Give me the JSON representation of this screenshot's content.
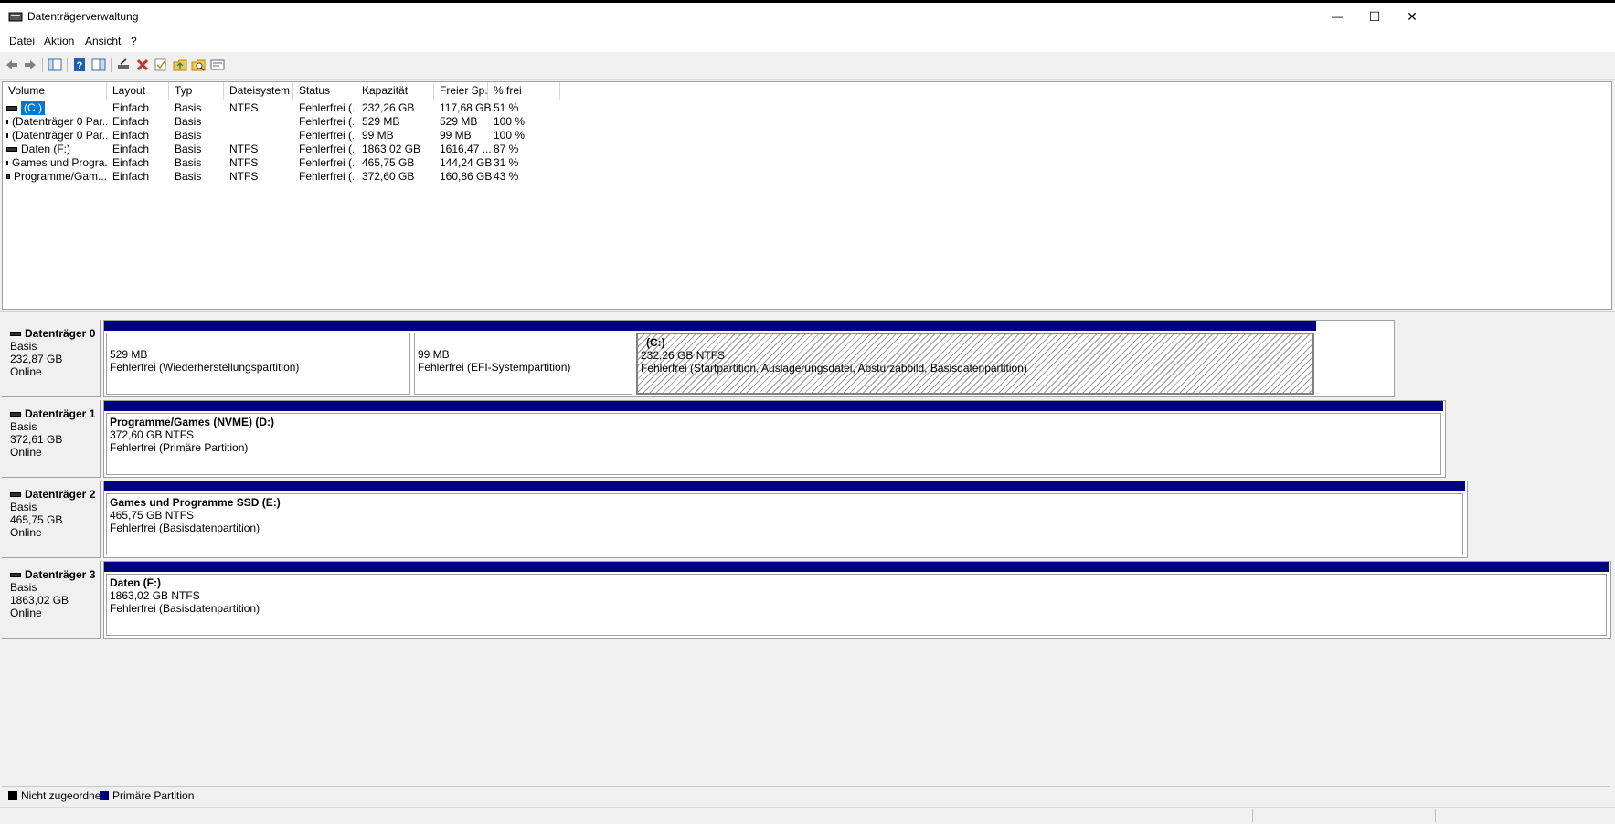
{
  "window": {
    "title": "Datenträgerverwaltung",
    "minimize_glyph": "—",
    "maximize_glyph": "☐",
    "close_glyph": "✕"
  },
  "menu": [
    "Datei",
    "Aktion",
    "Ansicht",
    "?"
  ],
  "toolbar_icons": [
    "back-icon",
    "forward-icon",
    "console-tree-icon",
    "help-icon",
    "action-pane-icon",
    "connect-disk-icon",
    "delete-icon",
    "check-icon",
    "folder-up-icon",
    "search-icon",
    "properties-icon"
  ],
  "columns": [
    "Volume",
    "Layout",
    "Typ",
    "Dateisystem",
    "Status",
    "Kapazität",
    "Freier Sp...",
    "% frei"
  ],
  "volumes": [
    {
      "volume": "(C:)",
      "layout": "Einfach",
      "typ": "Basis",
      "fs": "NTFS",
      "status": "Fehlerfrei (...",
      "kapazitaet": "232,26 GB",
      "frei": "117,68 GB",
      "prozent": "51 %"
    },
    {
      "volume": "(Datenträger 0 Par...",
      "layout": "Einfach",
      "typ": "Basis",
      "fs": "",
      "status": "Fehlerfrei (...",
      "kapazitaet": "529 MB",
      "frei": "529 MB",
      "prozent": "100 %"
    },
    {
      "volume": "(Datenträger 0 Par...",
      "layout": "Einfach",
      "typ": "Basis",
      "fs": "",
      "status": "Fehlerfrei (...",
      "kapazitaet": "99 MB",
      "frei": "99 MB",
      "prozent": "100 %"
    },
    {
      "volume": "Daten (F:)",
      "layout": "Einfach",
      "typ": "Basis",
      "fs": "NTFS",
      "status": "Fehlerfrei (...",
      "kapazitaet": "1863,02 GB",
      "frei": "1616,47 ...",
      "prozent": "87 %"
    },
    {
      "volume": "Games und Progra...",
      "layout": "Einfach",
      "typ": "Basis",
      "fs": "NTFS",
      "status": "Fehlerfrei (...",
      "kapazitaet": "465,75 GB",
      "frei": "144,24 GB",
      "prozent": "31 %"
    },
    {
      "volume": "Programme/Gam...",
      "layout": "Einfach",
      "typ": "Basis",
      "fs": "NTFS",
      "status": "Fehlerfrei (...",
      "kapazitaet": "372,60 GB",
      "frei": "160,86 GB",
      "prozent": "43 %"
    }
  ],
  "disks": [
    {
      "name": "Datenträger 0",
      "type": "Basis",
      "size": "232,87 GB",
      "state": "Online",
      "partitions": [
        {
          "name": "",
          "size": "529 MB",
          "status": "Fehlerfrei (Wiederherstellungspartition)"
        },
        {
          "name": "",
          "size": "99 MB",
          "status": "Fehlerfrei (EFI-Systempartition)"
        },
        {
          "name": "(C:)",
          "size": "232,26 GB NTFS",
          "status": "Fehlerfrei (Startpartition, Auslagerungsdatei, Absturzabbild, Basisdatenpartition)"
        }
      ]
    },
    {
      "name": "Datenträger 1",
      "type": "Basis",
      "size": "372,61 GB",
      "state": "Online",
      "partitions": [
        {
          "name": "Programme/Games (NVME)  (D:)",
          "size": "372,60 GB NTFS",
          "status": "Fehlerfrei (Primäre Partition)"
        }
      ]
    },
    {
      "name": "Datenträger 2",
      "type": "Basis",
      "size": "465,75 GB",
      "state": "Online",
      "partitions": [
        {
          "name": "Games und Programme SSD  (E:)",
          "size": "465,75 GB NTFS",
          "status": "Fehlerfrei (Basisdatenpartition)"
        }
      ]
    },
    {
      "name": "Datenträger 3",
      "type": "Basis",
      "size": "1863,02 GB",
      "state": "Online",
      "partitions": [
        {
          "name": "Daten  (F:)",
          "size": "1863,02 GB NTFS",
          "status": "Fehlerfrei (Basisdatenpartition)"
        }
      ]
    }
  ],
  "legend": [
    {
      "label": "Nicht zugeordnet",
      "color": "#000000"
    },
    {
      "label": "Primäre Partition",
      "color": "#000080"
    }
  ],
  "colors": {
    "partition_bar": "#000080",
    "selection": "#0078d7"
  }
}
